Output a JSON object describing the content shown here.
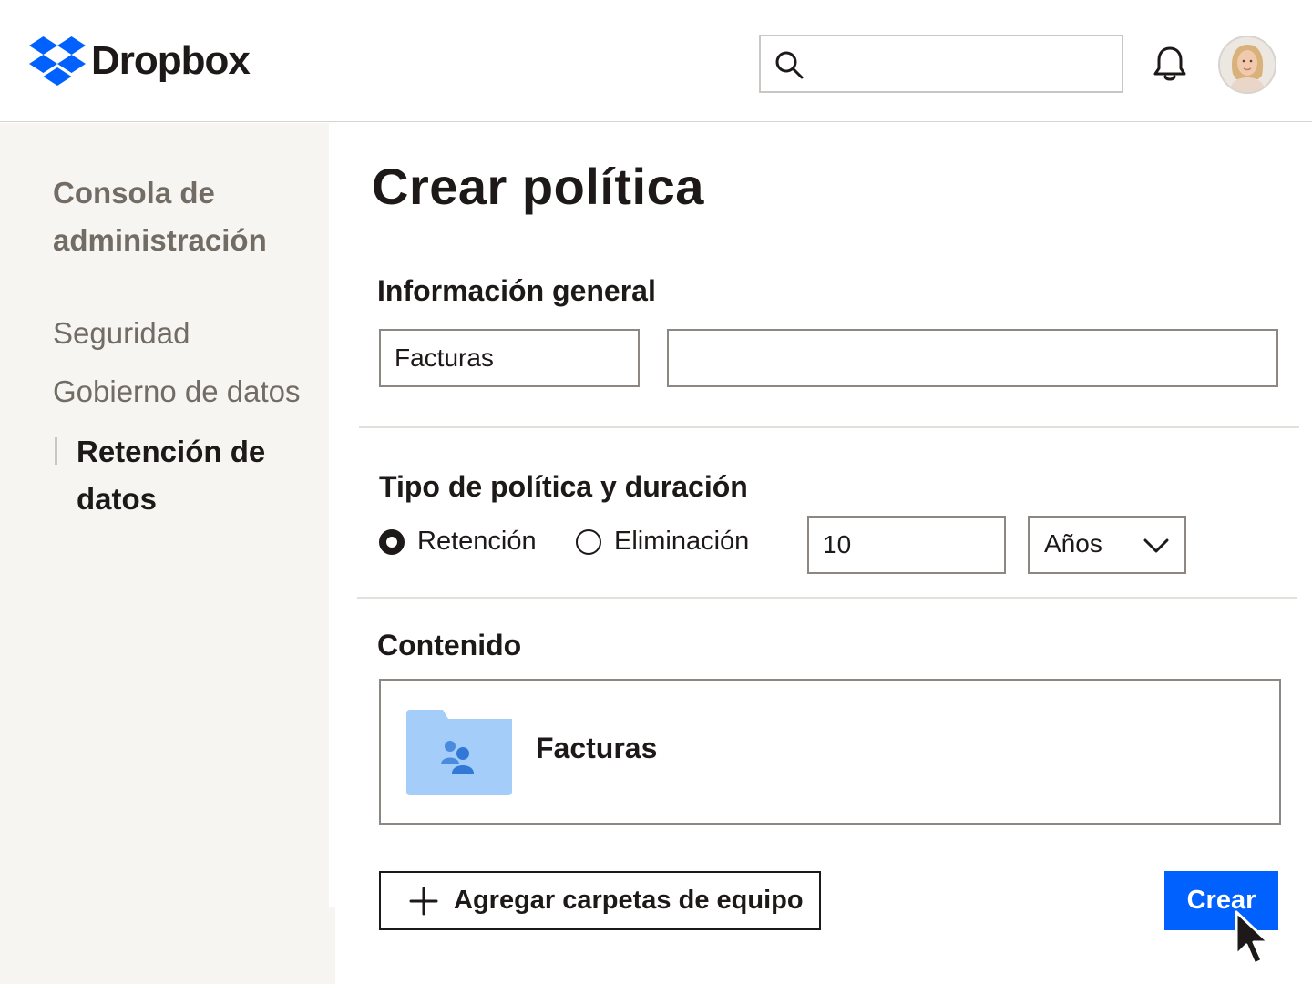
{
  "brand": {
    "name": "Dropbox",
    "color": "#0061fe"
  },
  "header": {
    "search": {
      "value": "",
      "placeholder": ""
    },
    "icons": [
      "search-icon",
      "bell-icon",
      "avatar"
    ]
  },
  "sidebar": {
    "heading": "Consola de administración",
    "items": [
      {
        "label": "Seguridad"
      },
      {
        "label": "Gobierno de datos"
      }
    ],
    "active_item": "Retención de datos"
  },
  "main": {
    "title": "Crear política",
    "general": {
      "title": "Información general",
      "name_value": "Facturas",
      "description_value": ""
    },
    "policy": {
      "title": "Tipo de política y duración",
      "options": [
        {
          "label": "Retención",
          "checked": true
        },
        {
          "label": "Eliminación",
          "checked": false
        }
      ],
      "duration_value": "10",
      "unit": "Años"
    },
    "content": {
      "title": "Contenido",
      "folder_name": "Facturas",
      "folder_icon": "shared-folder-icon"
    },
    "actions": {
      "add_label": "Agregar carpetas de equipo",
      "create_label": "Crear"
    }
  }
}
